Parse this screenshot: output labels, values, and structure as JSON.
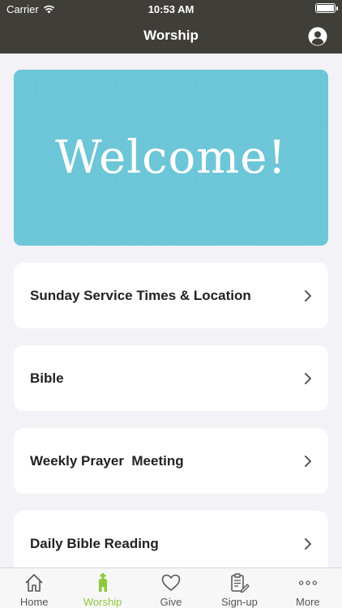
{
  "status_bar": {
    "carrier": "Carrier",
    "time": "10:53 AM"
  },
  "nav": {
    "title": "Worship"
  },
  "banner": {
    "text": "Welcome!"
  },
  "items": [
    {
      "label": "Sunday Service Times & Location"
    },
    {
      "label": "Bible"
    },
    {
      "label": "Weekly Prayer  Meeting"
    },
    {
      "label": "Daily Bible Reading"
    }
  ],
  "tabs": [
    {
      "label": "Home",
      "icon": "home-icon"
    },
    {
      "label": "Worship",
      "icon": "worship-icon",
      "active": true
    },
    {
      "label": "Give",
      "icon": "heart-icon"
    },
    {
      "label": "Sign-up",
      "icon": "clipboard-icon"
    },
    {
      "label": "More",
      "icon": "more-icon"
    }
  ],
  "colors": {
    "header": "#3f3e39",
    "banner": "#6cc6d8",
    "accent": "#8fc83c",
    "background": "#f2f2f7"
  }
}
